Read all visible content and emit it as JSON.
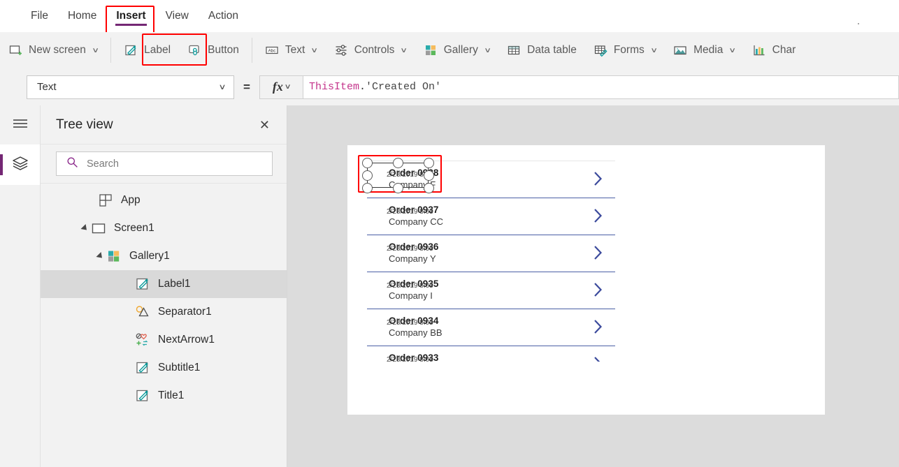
{
  "menu": {
    "items": [
      {
        "label": "File",
        "active": false
      },
      {
        "label": "Home",
        "active": false
      },
      {
        "label": "Insert",
        "active": true
      },
      {
        "label": "View",
        "active": false
      },
      {
        "label": "Action",
        "active": false
      }
    ]
  },
  "ribbon": {
    "groups": [
      {
        "items": [
          {
            "label": "New screen",
            "icon": "new-screen-icon",
            "caret": "∨"
          }
        ]
      },
      {
        "items": [
          {
            "label": "Label",
            "icon": "label-icon",
            "caret": ""
          },
          {
            "label": "Button",
            "icon": "button-icon",
            "caret": ""
          }
        ]
      },
      {
        "items": [
          {
            "label": "Text",
            "icon": "text-abc-icon",
            "caret": "∨"
          },
          {
            "label": "Controls",
            "icon": "controls-sliders-icon",
            "caret": "∨"
          },
          {
            "label": "Gallery",
            "icon": "gallery-squares-icon",
            "caret": "∨"
          },
          {
            "label": "Data table",
            "icon": "data-table-icon",
            "caret": ""
          },
          {
            "label": "Forms",
            "icon": "forms-icon",
            "caret": "∨"
          },
          {
            "label": "Media",
            "icon": "media-image-icon",
            "caret": "∨"
          },
          {
            "label": "Char",
            "icon": "charts-bar-icon",
            "caret": ""
          }
        ]
      }
    ]
  },
  "formula_bar": {
    "property_value": "Text",
    "property_caret": "∨",
    "equals": "=",
    "fx_label": "fx",
    "fx_caret": "∨",
    "formula": {
      "token_object": "ThisItem",
      "token_dot": ".",
      "token_string": "'Created On'"
    }
  },
  "rail": {
    "hamburger": "hamburger-icon",
    "tree_tab": "layers-icon",
    "accent_color": "#742774"
  },
  "tree_panel": {
    "title": "Tree view",
    "close_label": "✕",
    "search": {
      "placeholder": "Search",
      "value": ""
    },
    "items": [
      {
        "label": "App",
        "icon": "app-icon",
        "indent": 0,
        "expander": "none",
        "selected": false
      },
      {
        "label": "Screen1",
        "icon": "screen-icon",
        "indent": 0,
        "expander": "expanded",
        "selected": false
      },
      {
        "label": "Gallery1",
        "icon": "gallery-icon",
        "indent": 1,
        "expander": "expanded",
        "selected": false
      },
      {
        "label": "Label1",
        "icon": "label-icon",
        "indent": 2,
        "expander": "none",
        "selected": true
      },
      {
        "label": "Separator1",
        "icon": "separator-icon",
        "indent": 2,
        "expander": "none",
        "selected": false
      },
      {
        "label": "NextArrow1",
        "icon": "nextarrow-icon",
        "indent": 2,
        "expander": "none",
        "selected": false
      },
      {
        "label": "Subtitle1",
        "icon": "label-icon",
        "indent": 2,
        "expander": "none",
        "selected": false
      },
      {
        "label": "Title1",
        "icon": "label-icon",
        "indent": 2,
        "expander": "none",
        "selected": false
      }
    ]
  },
  "canvas": {
    "gallery_rows": [
      {
        "title": "Order 0938",
        "subtitle": "Company F",
        "date": "2/28/2019 8:05",
        "selected": true,
        "chevron": "chevron-right-icon"
      },
      {
        "title": "Order 0937",
        "subtitle": "Company CC",
        "date": "2/28/2019 8:05",
        "selected": false,
        "chevron": "chevron-right-icon"
      },
      {
        "title": "Order 0936",
        "subtitle": "Company Y",
        "date": "2/28/2019 8:05",
        "selected": false,
        "chevron": "chevron-right-icon"
      },
      {
        "title": "Order 0935",
        "subtitle": "Company I",
        "date": "2/28/2019 8:05",
        "selected": false,
        "chevron": "chevron-right-icon"
      },
      {
        "title": "Order 0934",
        "subtitle": "Company BB",
        "date": "2/28/2019 8:05",
        "selected": false,
        "chevron": "chevron-right-icon"
      },
      {
        "title": "Order 0933",
        "subtitle": "",
        "date": "2/28/2019 8:05",
        "selected": false,
        "chevron": "chevron-right-icon"
      }
    ]
  },
  "colors": {
    "accent_purple": "#742774",
    "annotation_red": "#ff0000",
    "gallery_separator": "#4a5fa5",
    "chevron": "#3b4a9c",
    "teal": "#0d9b9b",
    "selected_row_bg": "#d9d9d9"
  }
}
